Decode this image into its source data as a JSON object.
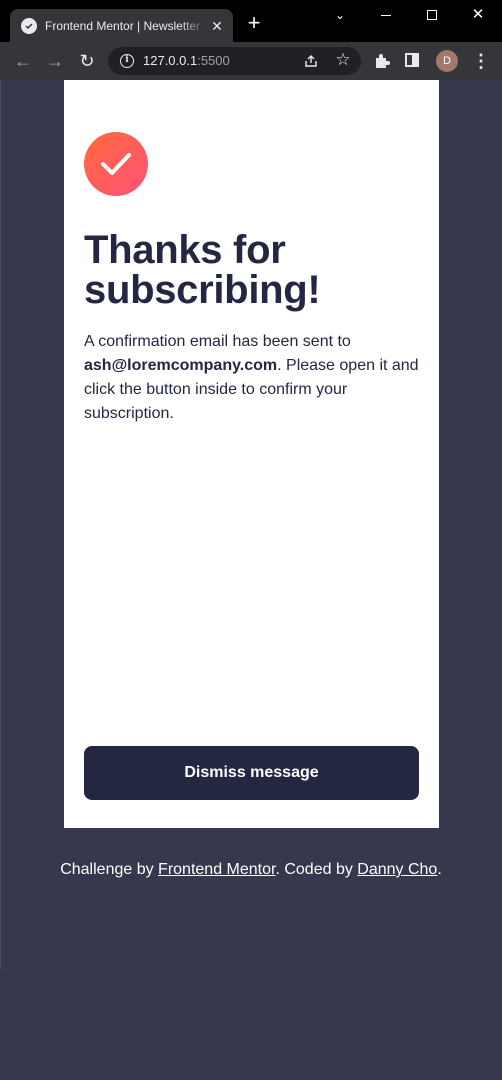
{
  "browser": {
    "tab_title": "Frontend Mentor | Newsletter sign-up form with success message",
    "tab_close_glyph": "✕",
    "new_tab_glyph": "+",
    "url_host": "127.0.0.1",
    "url_port": ":5500",
    "profile_initial": "D",
    "window_controls": {
      "minimize": "minimize-icon",
      "maximize": "maximize-icon",
      "close": "✕"
    },
    "icons": [
      "back-arrow-icon",
      "forward-arrow-icon",
      "reload-icon",
      "info-icon",
      "share-icon",
      "star-icon",
      "extensions-icon",
      "side-panel-icon",
      "menu-icon"
    ]
  },
  "success": {
    "icon": "checkmark-icon",
    "heading": "Thanks for subscribing!",
    "message_before": "A confirmation email has been sent to ",
    "email": "ash@loremcompany.com",
    "message_after": ". Please open it and click the button inside to confirm your subscription.",
    "button_label": "Dismiss message"
  },
  "attribution": {
    "prefix": "Challenge by ",
    "link1": "Frontend Mentor",
    "middle": ". Coded by ",
    "link2": "Danny Cho",
    "suffix": "."
  },
  "colors": {
    "page_background": "#36384d",
    "card_background": "#ffffff",
    "text_dark": "#242742",
    "button_background": "#242742",
    "icon_gradient_start": "#ff6a3a",
    "icon_gradient_end": "#ff527b"
  }
}
